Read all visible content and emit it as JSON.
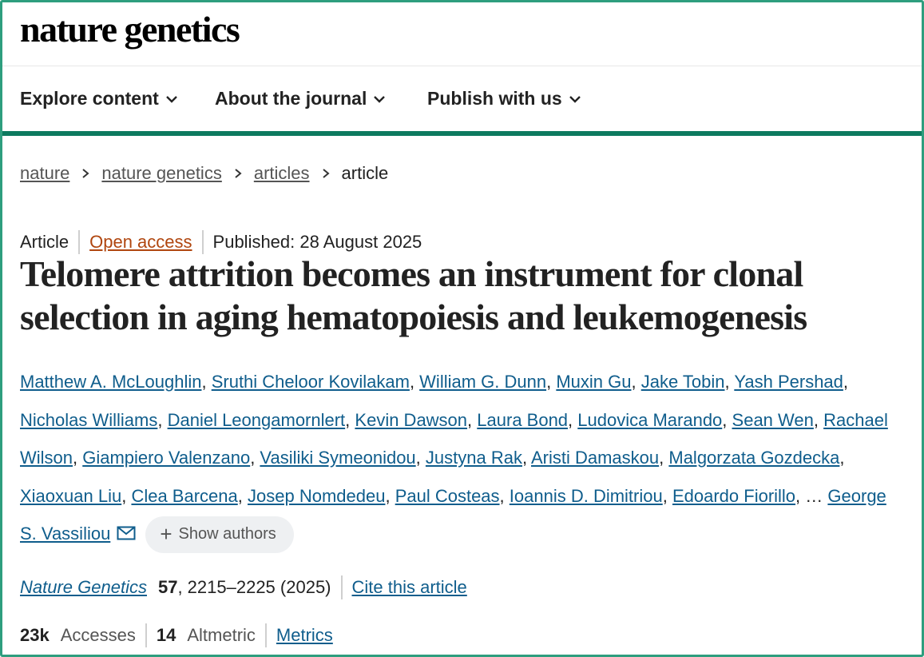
{
  "header": {
    "logo": "nature genetics"
  },
  "nav": {
    "items": [
      {
        "label": "Explore content"
      },
      {
        "label": "About the journal"
      },
      {
        "label": "Publish with us"
      }
    ]
  },
  "breadcrumb": {
    "items": [
      "nature",
      "nature genetics",
      "articles"
    ],
    "current": "article"
  },
  "article": {
    "type": "Article",
    "access": "Open access",
    "published": "Published: 28 August 2025",
    "title": "Telomere attrition becomes an instrument for clonal selection in aging hematopoiesis and leukemogenesis",
    "authors": [
      "Matthew A. McLoughlin",
      "Sruthi Cheloor Kovilakam",
      "William G. Dunn",
      "Muxin Gu",
      "Jake Tobin",
      "Yash Pershad",
      "Nicholas Williams",
      "Daniel Leongamornlert",
      "Kevin Dawson",
      "Laura Bond",
      "Ludovica Marando",
      "Sean Wen",
      "Rachael Wilson",
      "Giampiero Valenzano",
      "Vasiliki Symeonidou",
      "Justyna Rak",
      "Aristi Damaskou",
      "Malgorzata Gozdecka",
      "Xiaoxuan Liu",
      "Clea Barcena",
      "Josep Nomdedeu",
      "Paul Costeas",
      "Ioannis D. Dimitriou",
      "Edoardo Fiorillo"
    ],
    "ellipsis": "…",
    "last_author": "George S. Vassiliou",
    "show_authors": "Show authors",
    "citation": {
      "journal": "Nature Genetics",
      "volume": "57",
      "pages": ", 2215–2225 (2025)",
      "cite_link": "Cite this article"
    },
    "metrics": {
      "accesses_value": "23k",
      "accesses_label": "Accesses",
      "altmetric_value": "14",
      "altmetric_label": "Altmetric",
      "metrics_link": "Metrics"
    }
  },
  "colors": {
    "brand_green": "#0d7a5f",
    "link_blue": "#0f5d8c",
    "open_access_orange": "#b0460f"
  }
}
